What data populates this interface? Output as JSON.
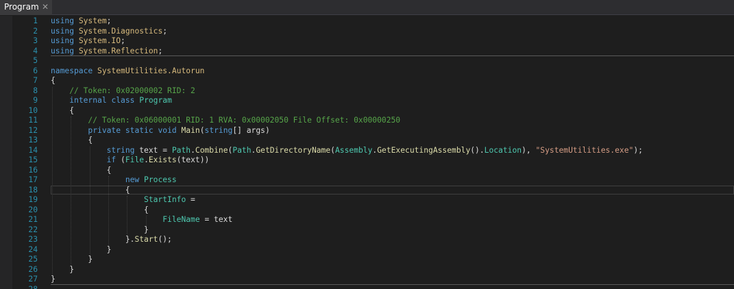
{
  "tab": {
    "title": "Program",
    "close_glyph": "✕",
    "close_icon": "close-icon"
  },
  "code_lines": [
    {
      "n": "1",
      "parts": [
        [
          "kw",
          "using"
        ],
        [
          "",
          " "
        ],
        [
          "ns",
          "System"
        ],
        [
          "",
          ";"
        ]
      ]
    },
    {
      "n": "2",
      "parts": [
        [
          "kw",
          "using"
        ],
        [
          "",
          " "
        ],
        [
          "ns",
          "System.Diagnostics"
        ],
        [
          "",
          ";"
        ]
      ]
    },
    {
      "n": "3",
      "parts": [
        [
          "kw",
          "using"
        ],
        [
          "",
          " "
        ],
        [
          "ns",
          "System.IO"
        ],
        [
          "",
          ";"
        ]
      ]
    },
    {
      "n": "4",
      "parts": [
        [
          "kw",
          "using"
        ],
        [
          "",
          " "
        ],
        [
          "ns",
          "System.Reflection"
        ],
        [
          "",
          ";"
        ]
      ]
    },
    {
      "n": "5",
      "parts": []
    },
    {
      "n": "6",
      "parts": [
        [
          "kw",
          "namespace"
        ],
        [
          "",
          " "
        ],
        [
          "ns",
          "SystemUtilities.Autorun"
        ]
      ]
    },
    {
      "n": "7",
      "parts": [
        [
          "",
          "{"
        ]
      ]
    },
    {
      "n": "8",
      "parts": [
        [
          "",
          "    "
        ],
        [
          "cm",
          "// Token: 0x02000002 RID: 2"
        ]
      ]
    },
    {
      "n": "9",
      "parts": [
        [
          "",
          "    "
        ],
        [
          "kw",
          "internal"
        ],
        [
          "",
          " "
        ],
        [
          "kw",
          "class"
        ],
        [
          "",
          " "
        ],
        [
          "ty",
          "Program"
        ]
      ]
    },
    {
      "n": "10",
      "parts": [
        [
          "",
          "    {"
        ]
      ]
    },
    {
      "n": "11",
      "parts": [
        [
          "",
          "        "
        ],
        [
          "cm",
          "// Token: 0x06000001 RID: 1 RVA: 0x00002050 File Offset: 0x00000250"
        ]
      ]
    },
    {
      "n": "12",
      "parts": [
        [
          "",
          "        "
        ],
        [
          "kw",
          "private"
        ],
        [
          "",
          " "
        ],
        [
          "kw",
          "static"
        ],
        [
          "",
          " "
        ],
        [
          "kw",
          "void"
        ],
        [
          "",
          " "
        ],
        [
          "fn",
          "Main"
        ],
        [
          "",
          "("
        ],
        [
          "kw",
          "string"
        ],
        [
          "",
          "[] args)"
        ]
      ]
    },
    {
      "n": "13",
      "parts": [
        [
          "",
          "        {"
        ]
      ]
    },
    {
      "n": "14",
      "parts": [
        [
          "",
          "            "
        ],
        [
          "kw",
          "string"
        ],
        [
          "",
          " text = "
        ],
        [
          "ty",
          "Path"
        ],
        [
          "",
          "."
        ],
        [
          "fn",
          "Combine"
        ],
        [
          "",
          "("
        ],
        [
          "ty",
          "Path"
        ],
        [
          "",
          "."
        ],
        [
          "fn",
          "GetDirectoryName"
        ],
        [
          "",
          "("
        ],
        [
          "ty",
          "Assembly"
        ],
        [
          "",
          "."
        ],
        [
          "fn",
          "GetExecutingAssembly"
        ],
        [
          "",
          "()."
        ],
        [
          "pr",
          "Location"
        ],
        [
          "",
          "), "
        ],
        [
          "str",
          "\"SystemUtilities.exe\""
        ],
        [
          "",
          ");"
        ]
      ]
    },
    {
      "n": "15",
      "parts": [
        [
          "",
          "            "
        ],
        [
          "kw",
          "if"
        ],
        [
          "",
          " ("
        ],
        [
          "ty",
          "File"
        ],
        [
          "",
          "."
        ],
        [
          "fn",
          "Exists"
        ],
        [
          "",
          "(text))"
        ]
      ]
    },
    {
      "n": "16",
      "parts": [
        [
          "",
          "            {"
        ]
      ]
    },
    {
      "n": "17",
      "parts": [
        [
          "",
          "                "
        ],
        [
          "kw",
          "new"
        ],
        [
          "",
          " "
        ],
        [
          "ty",
          "Process"
        ]
      ]
    },
    {
      "n": "18",
      "parts": [
        [
          "",
          "                {"
        ]
      ]
    },
    {
      "n": "19",
      "parts": [
        [
          "",
          "                    "
        ],
        [
          "pr",
          "StartInfo"
        ],
        [
          "",
          " ="
        ]
      ]
    },
    {
      "n": "20",
      "parts": [
        [
          "",
          "                    {"
        ]
      ]
    },
    {
      "n": "21",
      "parts": [
        [
          "",
          "                        "
        ],
        [
          "pr",
          "FileName"
        ],
        [
          "",
          " = text"
        ]
      ]
    },
    {
      "n": "22",
      "parts": [
        [
          "",
          "                    }"
        ]
      ]
    },
    {
      "n": "23",
      "parts": [
        [
          "",
          "                }."
        ],
        [
          "fn",
          "Start"
        ],
        [
          "",
          "();"
        ]
      ]
    },
    {
      "n": "24",
      "parts": [
        [
          "",
          "            }"
        ]
      ]
    },
    {
      "n": "25",
      "parts": [
        [
          "",
          "        }"
        ]
      ]
    },
    {
      "n": "26",
      "parts": [
        [
          "",
          "    }"
        ]
      ]
    },
    {
      "n": "27",
      "parts": [
        [
          "",
          "}"
        ]
      ]
    },
    {
      "n": "28",
      "parts": []
    }
  ]
}
